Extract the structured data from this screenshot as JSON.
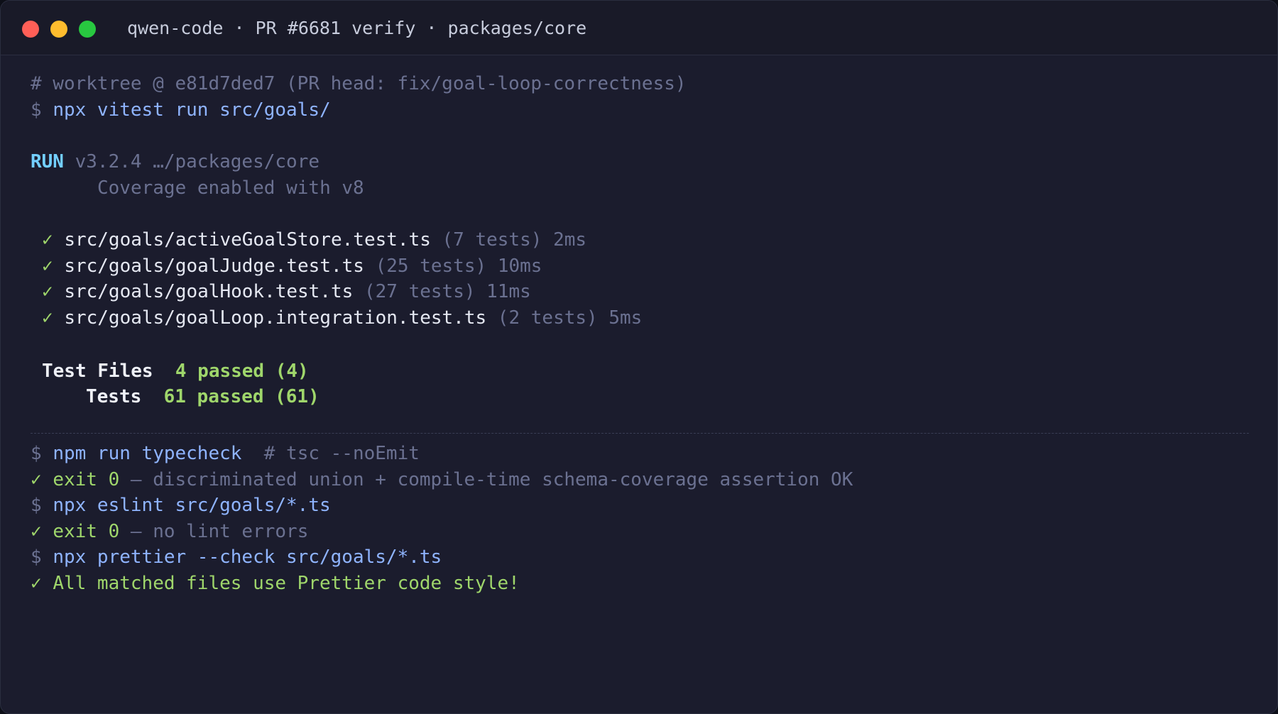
{
  "window": {
    "title": "qwen-code · PR #6681 verify · packages/core",
    "traffic_lights": {
      "close_color": "#ff5f57",
      "minimize_color": "#febc2e",
      "maximize_color": "#28c840"
    }
  },
  "terminal": {
    "worktree_comment": "# worktree @ e81d7ded7 (PR head: fix/goal-loop-correctness)",
    "prompt": "$",
    "cmd1": "npx vitest run src/goals/",
    "run_label": "RUN",
    "run_version": "v3.2.4 …/packages/core",
    "coverage": "Coverage enabled with v8",
    "check": "✓",
    "tests": [
      {
        "file": "src/goals/activeGoalStore.test.ts",
        "count": "(7 tests)",
        "time": "2ms"
      },
      {
        "file": "src/goals/goalJudge.test.ts",
        "count": "(25 tests)",
        "time": "10ms"
      },
      {
        "file": "src/goals/goalHook.test.ts",
        "count": "(27 tests)",
        "time": "11ms"
      },
      {
        "file": "src/goals/goalLoop.integration.test.ts",
        "count": "(2 tests)",
        "time": "5ms"
      }
    ],
    "summary": {
      "files_label": "Test Files",
      "files_value": "4 passed (4)",
      "tests_label": "Tests",
      "tests_value": "61 passed (61)"
    },
    "cmd2": "npm run typecheck",
    "cmd2_comment": "# tsc --noEmit",
    "exit_label": "exit 0",
    "exit2_msg": "— discriminated union + compile-time schema-coverage assertion OK",
    "cmd3": "npx eslint src/goals/*.ts",
    "exit3_msg": "— no lint errors",
    "cmd4": "npx prettier --check src/goals/*.ts",
    "prettier_msg": "All matched files use Prettier code style!"
  }
}
